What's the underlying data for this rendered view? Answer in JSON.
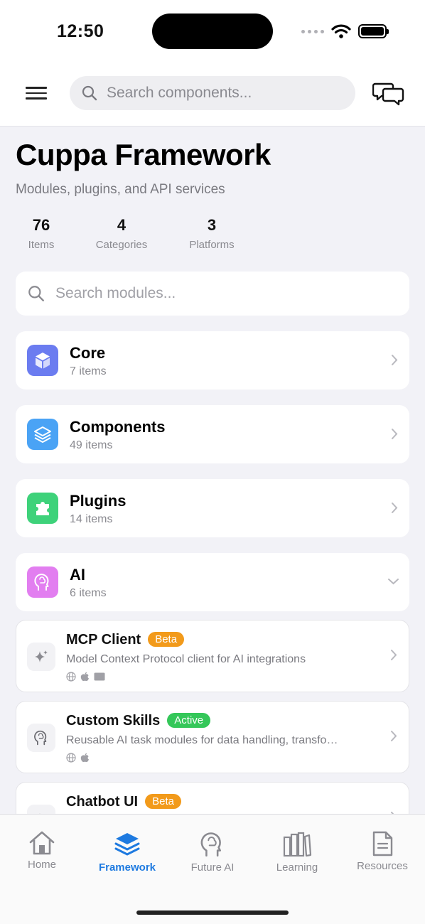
{
  "status": {
    "time": "12:50"
  },
  "header": {
    "search_placeholder": "Search components..."
  },
  "page": {
    "title": "Cuppa Framework",
    "subtitle": "Modules, plugins, and API services"
  },
  "stats": [
    {
      "value": "76",
      "label": "Items"
    },
    {
      "value": "4",
      "label": "Categories"
    },
    {
      "value": "3",
      "label": "Platforms"
    }
  ],
  "module_search": {
    "placeholder": "Search modules..."
  },
  "categories": [
    {
      "name": "Core",
      "count": "7 items",
      "icon": "cube-icon",
      "color": "#6b7cf0"
    },
    {
      "name": "Components",
      "count": "49 items",
      "icon": "layers-icon",
      "color": "#4aa3f5"
    },
    {
      "name": "Plugins",
      "count": "14 items",
      "icon": "puzzle-icon",
      "color": "#3ed27a"
    },
    {
      "name": "AI",
      "count": "6 items",
      "icon": "brain-icon",
      "color": "#e27ef0"
    }
  ],
  "ai_items": [
    {
      "name": "MCP Client",
      "badge": "Beta",
      "badge_color": "#f29a1a",
      "description": "Model Context Protocol client for AI integrations",
      "platforms": [
        "globe-icon",
        "apple-icon",
        "desktop-icon"
      ]
    },
    {
      "name": "Custom Skills",
      "badge": "Active",
      "badge_color": "#34c759",
      "description": "Reusable AI task modules for data handling, transfo…",
      "platforms": [
        "globe-icon",
        "apple-icon"
      ]
    },
    {
      "name": "Chatbot UI",
      "badge": "Beta",
      "badge_color": "#f29a1a",
      "description": "",
      "platforms": []
    }
  ],
  "tabs": [
    {
      "label": "Home",
      "icon": "home-icon",
      "active": false
    },
    {
      "label": "Framework",
      "icon": "layers-icon",
      "active": true
    },
    {
      "label": "Future AI",
      "icon": "brain-icon",
      "active": false
    },
    {
      "label": "Learning",
      "icon": "books-icon",
      "active": false
    },
    {
      "label": "Resources",
      "icon": "document-icon",
      "active": false
    }
  ],
  "colors": {
    "accent": "#1e7ae0"
  }
}
